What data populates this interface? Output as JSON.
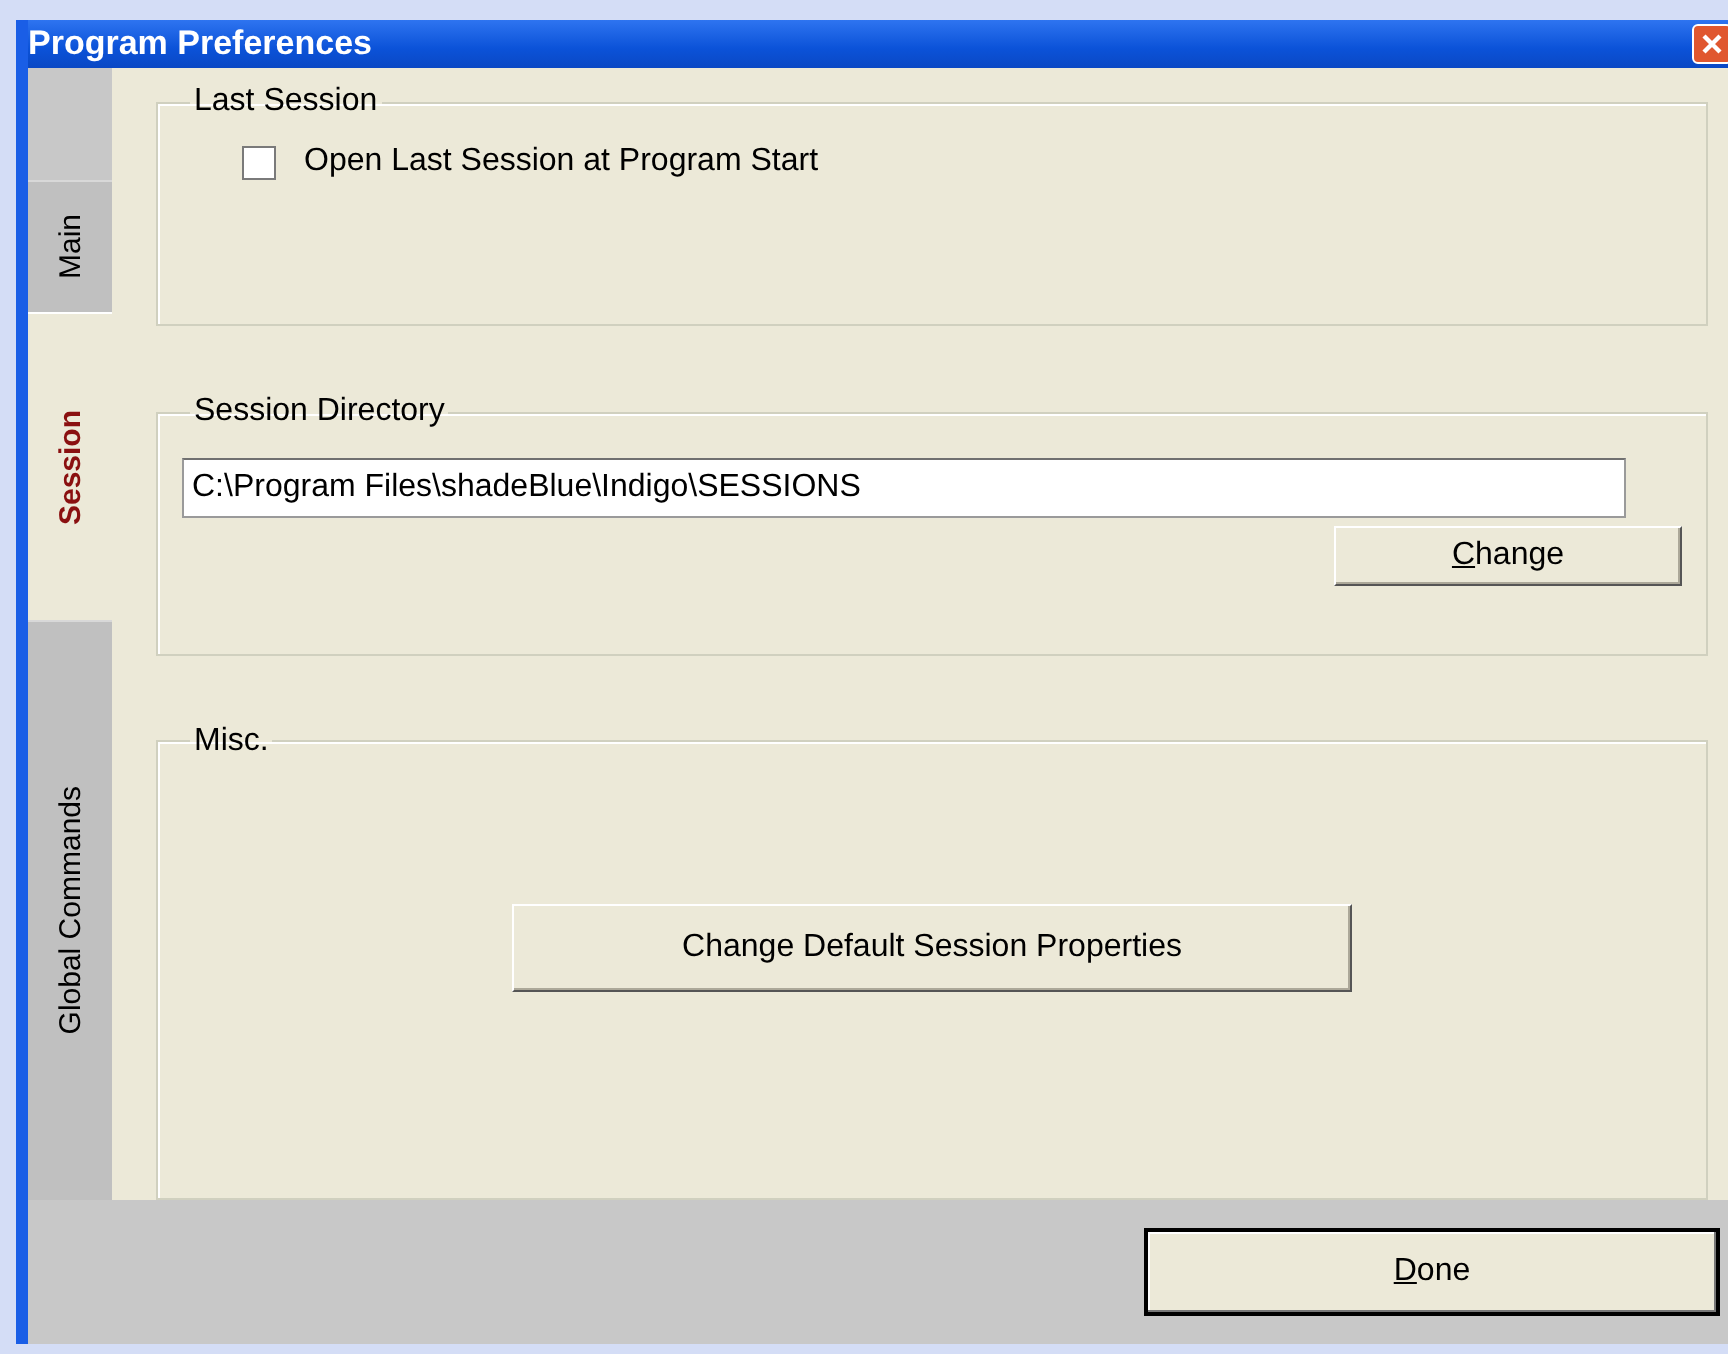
{
  "window": {
    "title": "Program Preferences"
  },
  "tabs": [
    {
      "label": "Main",
      "selected": false
    },
    {
      "label": "Session",
      "selected": true
    },
    {
      "label": "Global Commands",
      "selected": false
    }
  ],
  "last_session": {
    "legend": "Last Session",
    "checkbox": {
      "label": "Open Last Session at Program Start",
      "checked": false
    }
  },
  "session_directory": {
    "legend": "Session Directory",
    "path": "C:\\Program Files\\shadeBlue\\Indigo\\SESSIONS",
    "button": "Change"
  },
  "misc": {
    "legend": "Misc.",
    "button": "Change Default Session Properties"
  },
  "buttons": [
    "Done"
  ]
}
